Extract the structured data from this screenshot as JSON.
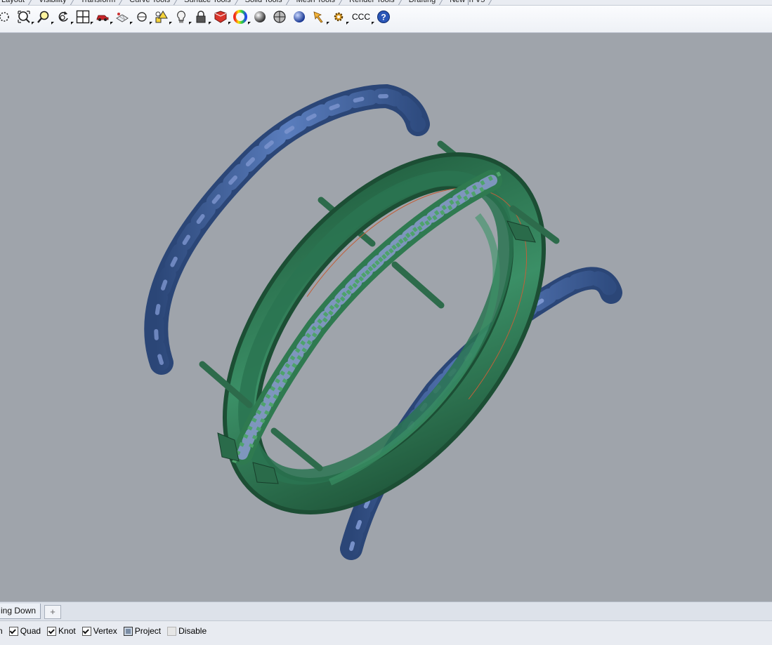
{
  "tabs": [
    "Layout",
    "Visibility",
    "Transform",
    "Curve Tools",
    "Surface Tools",
    "Solid Tools",
    "Mesh Tools",
    "Render Tools",
    "Drafting",
    "New in V5"
  ],
  "toolbar": {
    "icons": [
      "zoom-icon",
      "zoom-extents-icon",
      "zoom-window-icon",
      "rotate-view-icon",
      "four-viewports-icon",
      "car-icon",
      "construction-plane-icon",
      "point-object-icon",
      "properties-icon",
      "light-bulb-icon",
      "lock-icon",
      "layer-icon",
      "color-wheel-icon",
      "shaded-sphere-icon",
      "ghosted-sphere-icon",
      "rendered-sphere-icon",
      "pin-icon",
      "gear-icon",
      "ccc-label",
      "help-icon"
    ],
    "text_button": "CCC"
  },
  "viewport": {
    "background": "#9fa4ab",
    "ring_color": "#2f6e4f",
    "twist_color": "#3f5f97",
    "stone_color": "#7e96bd"
  },
  "view_tab": {
    "label": "ing Down",
    "add_label": "+"
  },
  "osnap": {
    "items": [
      {
        "label": "n",
        "checked": null
      },
      {
        "label": "Quad",
        "checked": true
      },
      {
        "label": "Knot",
        "checked": true
      },
      {
        "label": "Vertex",
        "checked": true
      },
      {
        "label": "Project",
        "checked": "filled"
      },
      {
        "label": "Disable",
        "checked": false
      }
    ]
  }
}
